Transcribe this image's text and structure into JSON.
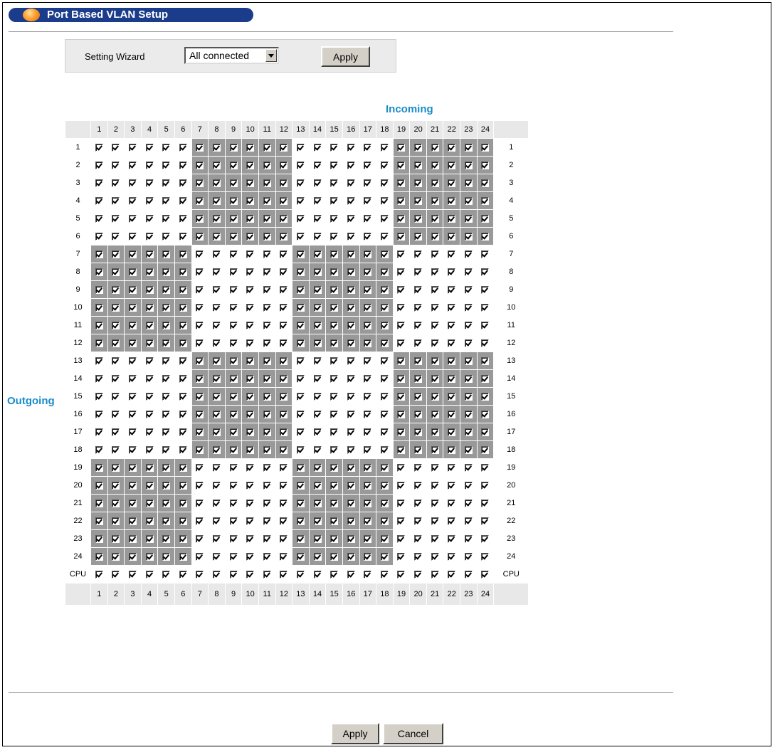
{
  "page": {
    "title": "Port Based VLAN Setup"
  },
  "wizard": {
    "label": "Setting Wizard",
    "selected": "All connected",
    "apply_label": "Apply"
  },
  "matrix": {
    "incoming_label": "Incoming",
    "outgoing_label": "Outgoing",
    "columns": [
      "1",
      "2",
      "3",
      "4",
      "5",
      "6",
      "7",
      "8",
      "9",
      "10",
      "11",
      "12",
      "13",
      "14",
      "15",
      "16",
      "17",
      "18",
      "19",
      "20",
      "21",
      "22",
      "23",
      "24"
    ],
    "rows": [
      "1",
      "2",
      "3",
      "4",
      "5",
      "6",
      "7",
      "8",
      "9",
      "10",
      "11",
      "12",
      "13",
      "14",
      "15",
      "16",
      "17",
      "18",
      "19",
      "20",
      "21",
      "22",
      "23",
      "24",
      "CPU"
    ],
    "all_checked": true
  },
  "footer": {
    "apply_label": "Apply",
    "cancel_label": "Cancel"
  },
  "colors": {
    "title_bar": "#1a3c8a",
    "label_blue": "#1a8cc8",
    "shaded_cell": "#999999",
    "header_bg": "#e8e8e8"
  }
}
